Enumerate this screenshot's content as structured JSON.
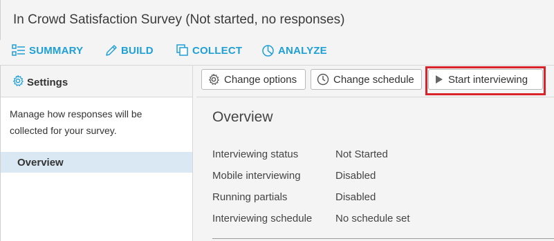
{
  "window": {
    "title": "In Crowd Satisfaction Survey (Not started, no responses)"
  },
  "nav": {
    "items": [
      {
        "label": "SUMMARY",
        "icon": "summary-icon"
      },
      {
        "label": "BUILD",
        "icon": "pencil-icon"
      },
      {
        "label": "COLLECT",
        "icon": "copy-icon"
      },
      {
        "label": "ANALYZE",
        "icon": "pie-chart-icon"
      }
    ],
    "accent_color": "#1e9fd6"
  },
  "sidebar": {
    "header": "Settings",
    "description": "Manage how responses will be collected for your survey.",
    "items": [
      {
        "label": "Overview",
        "selected": true
      }
    ]
  },
  "toolbar": {
    "change_options": "Change options",
    "change_schedule": "Change schedule",
    "start_interviewing": "Start interviewing",
    "highlight_color": "#d9222a"
  },
  "overview": {
    "title": "Overview",
    "rows": [
      {
        "label": "Interviewing status",
        "value": "Not Started"
      },
      {
        "label": "Mobile interviewing",
        "value": "Disabled"
      },
      {
        "label": "Running partials",
        "value": "Disabled"
      },
      {
        "label": "Interviewing schedule",
        "value": "No schedule set"
      }
    ]
  }
}
